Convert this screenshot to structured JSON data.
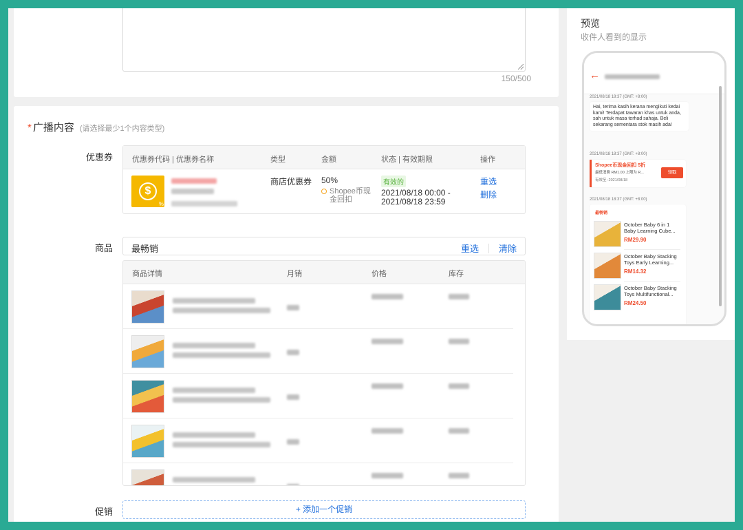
{
  "textarea": {
    "char_count": "150/500"
  },
  "broadcast": {
    "title": "广播内容",
    "required_mark": "*",
    "hint": "(请选择最少1个内容类型)"
  },
  "voucher": {
    "label": "优惠券",
    "headers": [
      "优惠券代码 | 优惠券名称",
      "类型",
      "金额",
      "状态 | 有效期限",
      "操作"
    ],
    "row": {
      "type": "商店优惠券",
      "amount": "50%",
      "amount_note": "Shopee币现金回扣",
      "status": "有效的",
      "period_start": "2021/08/18 00:00 -",
      "period_end": "2021/08/18 23:59",
      "action_reselect": "重选",
      "action_delete": "删除"
    },
    "image_symbol": "$",
    "image_pct": "%"
  },
  "products": {
    "label": "商品",
    "select_value": "最畅销",
    "reselect": "重选",
    "clear": "清除",
    "headers": [
      "商品详情",
      "月销",
      "价格",
      "库存"
    ],
    "row_count": 5
  },
  "promotion": {
    "label": "促销",
    "add_label": "+ 添加一个促销"
  },
  "preview": {
    "title": "预览",
    "subtitle": "收件人看到的显示",
    "timestamp": "2021/08/18 18:37 (GMT: +8:00)",
    "message": "Hai, terima kasih kerana mengikuti kedai kami! Terdapat tawaran khas untuk anda, sah untuk masa terhad sahaja. Beli sekarang sementara stok masih ada!",
    "voucher_title": "Shopee币现金回扣 5折",
    "voucher_line": "最低消费 RM1.00 上限为 R...",
    "voucher_valid": "有效至:  2021/08/18",
    "voucher_btn": "领取",
    "best_seller_tag": "最畅销",
    "items": [
      {
        "name": "October Baby 6 in 1 Baby Learning Cube...",
        "price": "RM29.90"
      },
      {
        "name": "October Baby Stacking Toys Early Learning...",
        "price": "RM14.32"
      },
      {
        "name": "October Baby Stacking Toys Multifunctional...",
        "price": "RM24.50"
      }
    ]
  },
  "colors": {
    "accent": "#ee4d2d",
    "link": "#2673dd",
    "frame": "#2aaa94"
  }
}
